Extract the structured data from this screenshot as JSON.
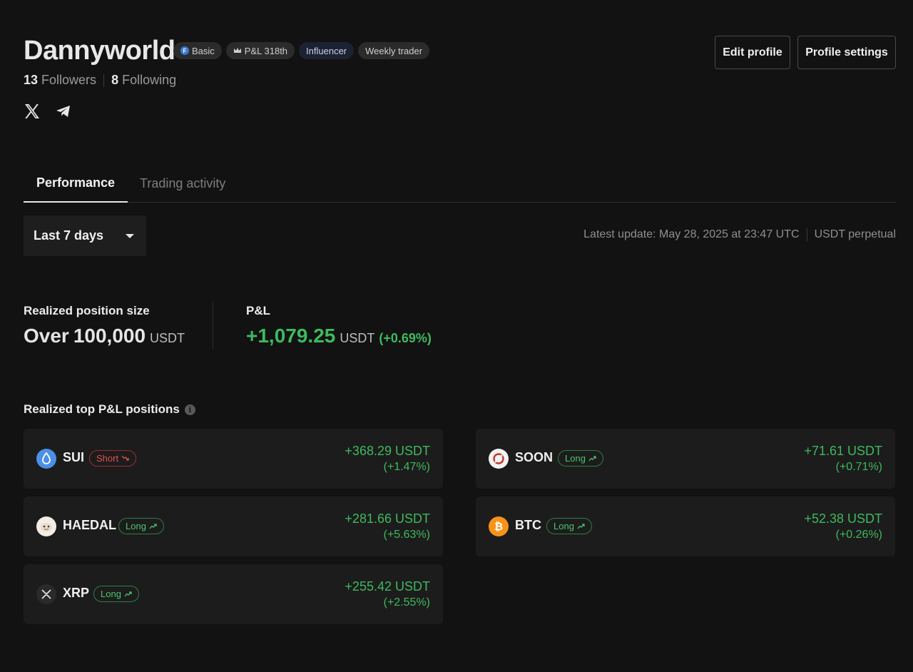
{
  "profile": {
    "name": "Dannyworld",
    "badges": [
      "Basic",
      "P&L 318th",
      "Influencer",
      "Weekly trader"
    ],
    "followers_count": "13",
    "followers_label": "Followers",
    "following_count": "8",
    "following_label": "Following",
    "socials": [
      "x-icon",
      "telegram-icon"
    ]
  },
  "actions": {
    "edit_label": "Edit profile",
    "settings_label": "Profile settings"
  },
  "tabs": [
    {
      "label": "Performance",
      "active": true
    },
    {
      "label": "Trading activity",
      "active": false
    }
  ],
  "filter": {
    "period": "Last 7 days",
    "latest_update": "Latest update: May 28, 2025 at 23:47 UTC",
    "market": "USDT perpetual"
  },
  "stats": {
    "size_label": "Realized position size",
    "size_prefix": "Over",
    "size_value": "100,000",
    "size_unit": "USDT",
    "pnl_label": "P&L",
    "pnl_value": "+1,079.25",
    "pnl_unit": "USDT",
    "pnl_pct": "(+0.69%)"
  },
  "positions": {
    "title": "Realized top P&L positions",
    "items": [
      {
        "coin": "SUI",
        "side": "Short",
        "pnl": "+368.29 USDT",
        "pct": "(+1.47%)"
      },
      {
        "coin": "SOON",
        "side": "Long",
        "pnl": "+71.61 USDT",
        "pct": "(+0.71%)"
      },
      {
        "coin": "HAEDAL",
        "side": "Long",
        "pnl": "+281.66 USDT",
        "pct": "(+5.63%)"
      },
      {
        "coin": "BTC",
        "side": "Long",
        "pnl": "+52.38 USDT",
        "pct": "(+0.26%)"
      },
      {
        "coin": "XRP",
        "side": "Long",
        "pnl": "+255.42 USDT",
        "pct": "(+2.55%)"
      }
    ]
  },
  "colors": {
    "background": "#121212",
    "card": "#1c1c1c",
    "positive": "#3fb95f",
    "negative": "#e05252"
  }
}
